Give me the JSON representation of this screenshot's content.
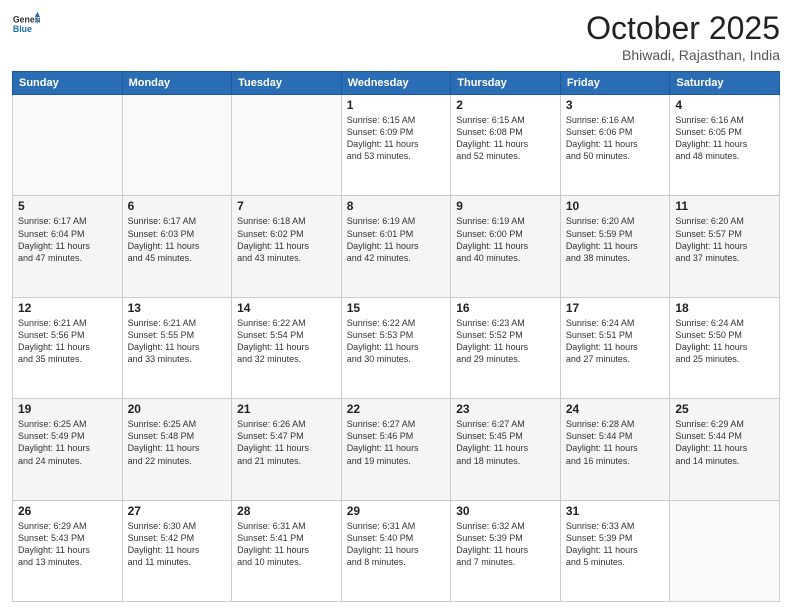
{
  "logo": {
    "general": "General",
    "blue": "Blue"
  },
  "header": {
    "month": "October 2025",
    "location": "Bhiwadi, Rajasthan, India"
  },
  "weekdays": [
    "Sunday",
    "Monday",
    "Tuesday",
    "Wednesday",
    "Thursday",
    "Friday",
    "Saturday"
  ],
  "weeks": [
    [
      {
        "day": "",
        "info": ""
      },
      {
        "day": "",
        "info": ""
      },
      {
        "day": "",
        "info": ""
      },
      {
        "day": "1",
        "info": "Sunrise: 6:15 AM\nSunset: 6:09 PM\nDaylight: 11 hours\nand 53 minutes."
      },
      {
        "day": "2",
        "info": "Sunrise: 6:15 AM\nSunset: 6:08 PM\nDaylight: 11 hours\nand 52 minutes."
      },
      {
        "day": "3",
        "info": "Sunrise: 6:16 AM\nSunset: 6:06 PM\nDaylight: 11 hours\nand 50 minutes."
      },
      {
        "day": "4",
        "info": "Sunrise: 6:16 AM\nSunset: 6:05 PM\nDaylight: 11 hours\nand 48 minutes."
      }
    ],
    [
      {
        "day": "5",
        "info": "Sunrise: 6:17 AM\nSunset: 6:04 PM\nDaylight: 11 hours\nand 47 minutes."
      },
      {
        "day": "6",
        "info": "Sunrise: 6:17 AM\nSunset: 6:03 PM\nDaylight: 11 hours\nand 45 minutes."
      },
      {
        "day": "7",
        "info": "Sunrise: 6:18 AM\nSunset: 6:02 PM\nDaylight: 11 hours\nand 43 minutes."
      },
      {
        "day": "8",
        "info": "Sunrise: 6:19 AM\nSunset: 6:01 PM\nDaylight: 11 hours\nand 42 minutes."
      },
      {
        "day": "9",
        "info": "Sunrise: 6:19 AM\nSunset: 6:00 PM\nDaylight: 11 hours\nand 40 minutes."
      },
      {
        "day": "10",
        "info": "Sunrise: 6:20 AM\nSunset: 5:59 PM\nDaylight: 11 hours\nand 38 minutes."
      },
      {
        "day": "11",
        "info": "Sunrise: 6:20 AM\nSunset: 5:57 PM\nDaylight: 11 hours\nand 37 minutes."
      }
    ],
    [
      {
        "day": "12",
        "info": "Sunrise: 6:21 AM\nSunset: 5:56 PM\nDaylight: 11 hours\nand 35 minutes."
      },
      {
        "day": "13",
        "info": "Sunrise: 6:21 AM\nSunset: 5:55 PM\nDaylight: 11 hours\nand 33 minutes."
      },
      {
        "day": "14",
        "info": "Sunrise: 6:22 AM\nSunset: 5:54 PM\nDaylight: 11 hours\nand 32 minutes."
      },
      {
        "day": "15",
        "info": "Sunrise: 6:22 AM\nSunset: 5:53 PM\nDaylight: 11 hours\nand 30 minutes."
      },
      {
        "day": "16",
        "info": "Sunrise: 6:23 AM\nSunset: 5:52 PM\nDaylight: 11 hours\nand 29 minutes."
      },
      {
        "day": "17",
        "info": "Sunrise: 6:24 AM\nSunset: 5:51 PM\nDaylight: 11 hours\nand 27 minutes."
      },
      {
        "day": "18",
        "info": "Sunrise: 6:24 AM\nSunset: 5:50 PM\nDaylight: 11 hours\nand 25 minutes."
      }
    ],
    [
      {
        "day": "19",
        "info": "Sunrise: 6:25 AM\nSunset: 5:49 PM\nDaylight: 11 hours\nand 24 minutes."
      },
      {
        "day": "20",
        "info": "Sunrise: 6:25 AM\nSunset: 5:48 PM\nDaylight: 11 hours\nand 22 minutes."
      },
      {
        "day": "21",
        "info": "Sunrise: 6:26 AM\nSunset: 5:47 PM\nDaylight: 11 hours\nand 21 minutes."
      },
      {
        "day": "22",
        "info": "Sunrise: 6:27 AM\nSunset: 5:46 PM\nDaylight: 11 hours\nand 19 minutes."
      },
      {
        "day": "23",
        "info": "Sunrise: 6:27 AM\nSunset: 5:45 PM\nDaylight: 11 hours\nand 18 minutes."
      },
      {
        "day": "24",
        "info": "Sunrise: 6:28 AM\nSunset: 5:44 PM\nDaylight: 11 hours\nand 16 minutes."
      },
      {
        "day": "25",
        "info": "Sunrise: 6:29 AM\nSunset: 5:44 PM\nDaylight: 11 hours\nand 14 minutes."
      }
    ],
    [
      {
        "day": "26",
        "info": "Sunrise: 6:29 AM\nSunset: 5:43 PM\nDaylight: 11 hours\nand 13 minutes."
      },
      {
        "day": "27",
        "info": "Sunrise: 6:30 AM\nSunset: 5:42 PM\nDaylight: 11 hours\nand 11 minutes."
      },
      {
        "day": "28",
        "info": "Sunrise: 6:31 AM\nSunset: 5:41 PM\nDaylight: 11 hours\nand 10 minutes."
      },
      {
        "day": "29",
        "info": "Sunrise: 6:31 AM\nSunset: 5:40 PM\nDaylight: 11 hours\nand 8 minutes."
      },
      {
        "day": "30",
        "info": "Sunrise: 6:32 AM\nSunset: 5:39 PM\nDaylight: 11 hours\nand 7 minutes."
      },
      {
        "day": "31",
        "info": "Sunrise: 6:33 AM\nSunset: 5:39 PM\nDaylight: 11 hours\nand 5 minutes."
      },
      {
        "day": "",
        "info": ""
      }
    ]
  ]
}
